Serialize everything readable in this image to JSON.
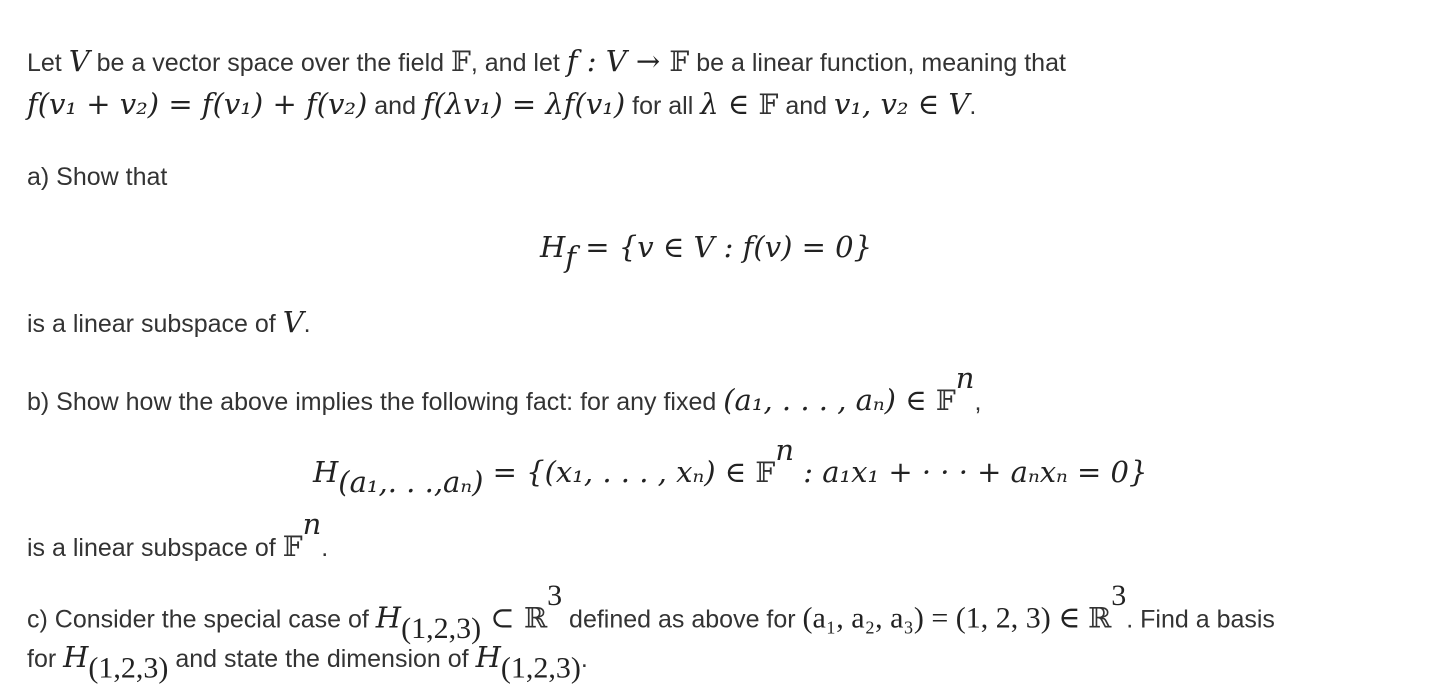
{
  "intro": {
    "line1": {
      "t1": "Let ",
      "V": "V",
      "t2": " be a vector space over the field ",
      "F": "𝔽",
      "t3": ", and let ",
      "map": "f : V → ",
      "F2": "𝔽",
      "t4": " be a linear function, meaning that"
    },
    "line2": {
      "eq1": "f(v₁ + v₂) = f(v₁) + f(v₂)",
      "t1": " and ",
      "eq2": "f(λv₁) = λf(v₁)",
      "t2": " for all ",
      "lam": "λ ∈ ",
      "F": "𝔽",
      "t3": " and ",
      "vs": "v₁, v₂ ∈ V",
      "t4": "."
    }
  },
  "part_a": {
    "label": "a) Show that",
    "display": "H",
    "display_sub": "f",
    "display_rest": " = {v ∈ V  :  f(v) = 0}",
    "conclusion_text": "is a linear subspace of ",
    "conclusion_math": "V",
    "conclusion_end": "."
  },
  "part_b": {
    "text": "b) Show how the above implies the following fact: for any fixed ",
    "tuple": "(a₁, . . . , aₙ) ∈ ",
    "F": "𝔽",
    "sup": "n",
    "end": ",",
    "display_H": "H",
    "display_sub": "(a₁,. . .,aₙ)",
    "display_rest1": " = {(x₁, . . . , xₙ) ∈ ",
    "display_F": "𝔽",
    "display_sup": "n",
    "display_rest2": "  :  a₁x₁ + · · · + aₙxₙ = 0}",
    "conclusion_text": "is a linear subspace of ",
    "conclusion_F": "𝔽",
    "conclusion_sup": "n",
    "conclusion_end": "."
  },
  "part_c": {
    "t1": "c) Consider the special case of ",
    "H": "H",
    "sub": "(1,2,3)",
    "subset": " ⊂ ",
    "R": "ℝ",
    "sup": "3",
    "t2": " defined as above for ",
    "eq": "(a₁, a₂, a₃) = (1, 2, 3) ∈ ",
    "R2": "ℝ",
    "sup2": "3",
    "t3": ". Find a basis",
    "t4": "for ",
    "t5": " and state the dimension of ",
    "t6": "."
  }
}
